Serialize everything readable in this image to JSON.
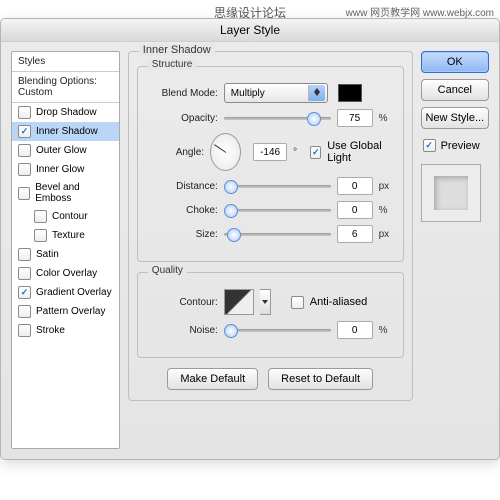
{
  "watermark_center": "思缘设计论坛",
  "watermark_right": "www 网页教学网 www.webjx.com",
  "dialog_title": "Layer Style",
  "sidebar": {
    "header": "Styles",
    "subheader": "Blending Options: Custom",
    "items": [
      {
        "label": "Drop Shadow",
        "checked": false
      },
      {
        "label": "Inner Shadow",
        "checked": true,
        "selected": true
      },
      {
        "label": "Outer Glow",
        "checked": false
      },
      {
        "label": "Inner Glow",
        "checked": false
      },
      {
        "label": "Bevel and Emboss",
        "checked": false
      },
      {
        "label": "Contour",
        "checked": false,
        "indent": true
      },
      {
        "label": "Texture",
        "checked": false,
        "indent": true
      },
      {
        "label": "Satin",
        "checked": false
      },
      {
        "label": "Color Overlay",
        "checked": false
      },
      {
        "label": "Gradient Overlay",
        "checked": true
      },
      {
        "label": "Pattern Overlay",
        "checked": false
      },
      {
        "label": "Stroke",
        "checked": false
      }
    ]
  },
  "panel": {
    "outer_title": "Inner Shadow",
    "structure": {
      "title": "Structure",
      "blend_mode_label": "Blend Mode:",
      "blend_mode_value": "Multiply",
      "opacity_label": "Opacity:",
      "opacity_value": "75",
      "opacity_unit": "%",
      "angle_label": "Angle:",
      "angle_value": "-146",
      "angle_unit": "°",
      "use_global_label": "Use Global Light",
      "use_global_checked": true,
      "distance_label": "Distance:",
      "distance_value": "0",
      "distance_unit": "px",
      "choke_label": "Choke:",
      "choke_value": "0",
      "choke_unit": "%",
      "size_label": "Size:",
      "size_value": "6",
      "size_unit": "px"
    },
    "quality": {
      "title": "Quality",
      "contour_label": "Contour:",
      "antialiased_label": "Anti-aliased",
      "noise_label": "Noise:",
      "noise_value": "0",
      "noise_unit": "%"
    },
    "make_default": "Make Default",
    "reset_default": "Reset to Default"
  },
  "buttons": {
    "ok": "OK",
    "cancel": "Cancel",
    "new_style": "New Style...",
    "preview": "Preview"
  }
}
